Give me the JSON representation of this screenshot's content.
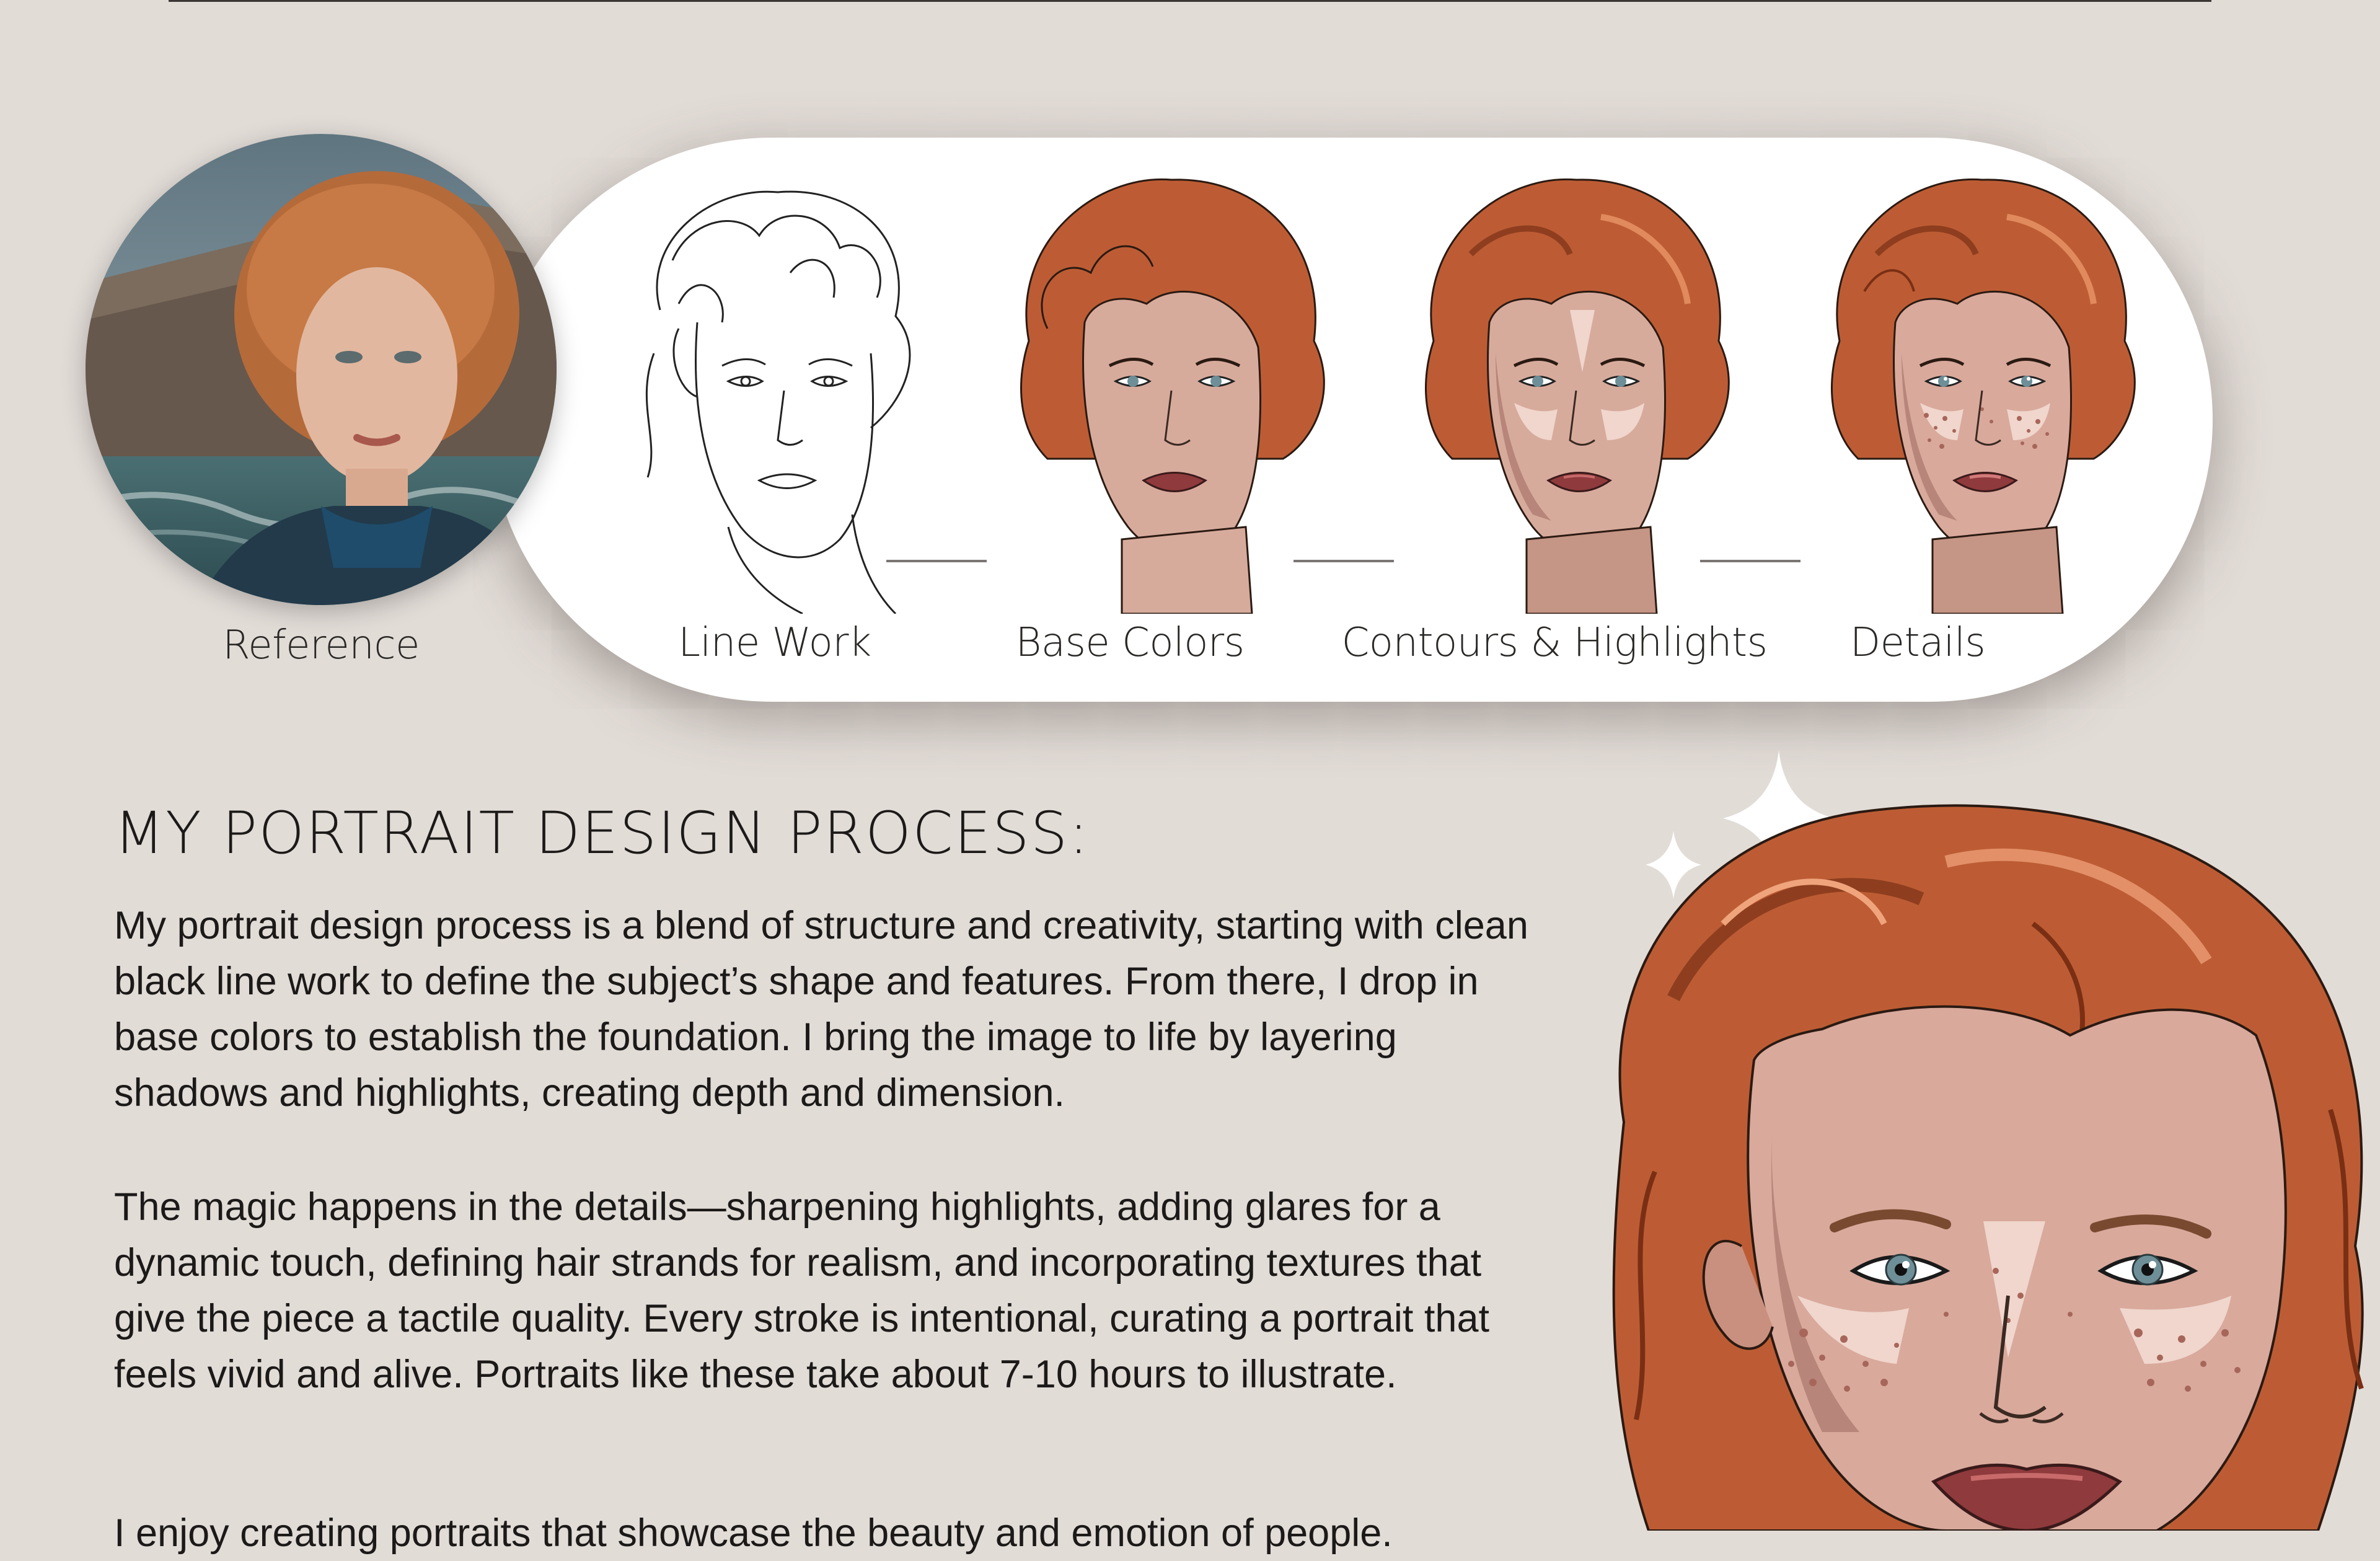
{
  "steps": {
    "reference": "Reference",
    "line_work": "Line Work",
    "base_colors": "Base Colors",
    "contours": "Contours & Highlights",
    "details": "Details"
  },
  "heading": "MY PORTRAIT DESIGN PROCESS:",
  "paragraphs": [
    "My portrait design process is a blend of structure and creativity, starting with clean black line work to define the subject’s shape and features. From there, I drop in base colors to establish the foundation. I bring the image to life by layering shadows and highlights, creating depth and dimension.",
    "The magic happens in the details—sharpening highlights, adding glares for a dynamic touch, defining hair strands for realism, and incorporating textures that give the piece a tactile quality. Every stroke is intentional, curating a portrait that feels vivid and alive. Portraits like these take about 7-10 hours to illustrate.",
    "I enjoy creating portraits that showcase the beauty and emotion of people."
  ],
  "colors": {
    "background": "#e2dcd7",
    "hair": "#bd5c34",
    "skin": "#d7ab9c",
    "lips": "#8f3a3c",
    "eyes": "#6e8f98"
  }
}
